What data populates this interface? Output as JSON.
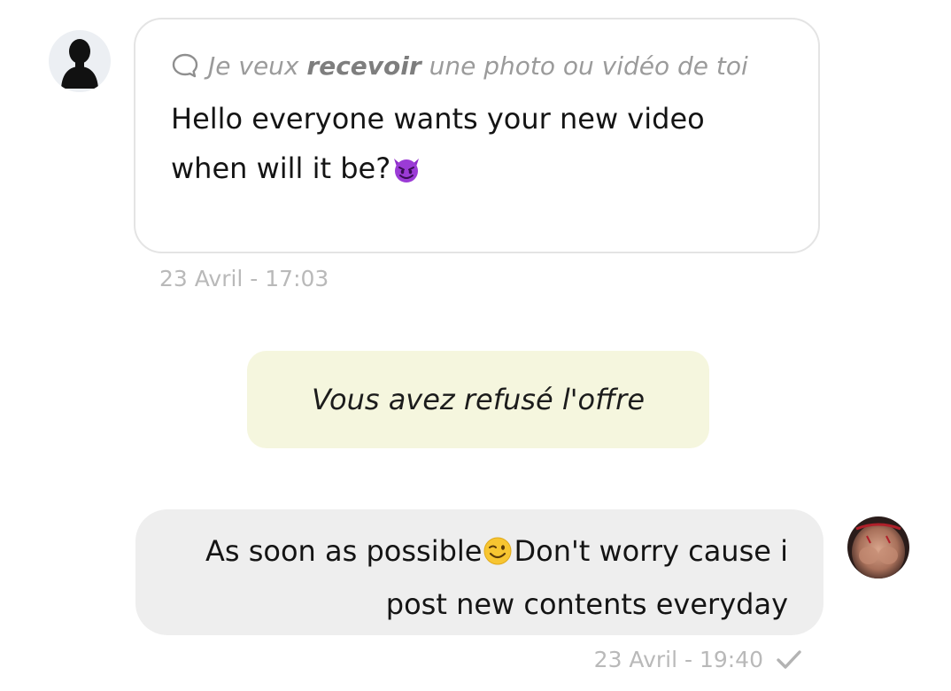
{
  "incoming_message": {
    "request_prefix": "Je veux",
    "request_bold": "recevoir",
    "request_suffix": "une photo ou vidéo de toi",
    "text": "Hello everyone wants your new video when will it be?",
    "emoji": "smiling-devil",
    "timestamp": "23 Avril - 17:03",
    "icons": {
      "avatar": "default-user-silhouette",
      "request": "chat-bubble-icon"
    }
  },
  "system_notice": {
    "text": "Vous avez refusé l'offre",
    "background": "#f5f6de"
  },
  "outgoing_message": {
    "text_part1": "As soon as possible",
    "emoji": "winking-face",
    "text_part2": "Don't worry cause i post new contents everyday",
    "timestamp": "23 Avril - 19:40",
    "status_icon": "check-icon"
  },
  "colors": {
    "bubble_border": "#e4e4e4",
    "outgoing_bubble": "#eeeeee",
    "timestamp": "#b9b9b9",
    "request_text": "#9b9b9b"
  }
}
